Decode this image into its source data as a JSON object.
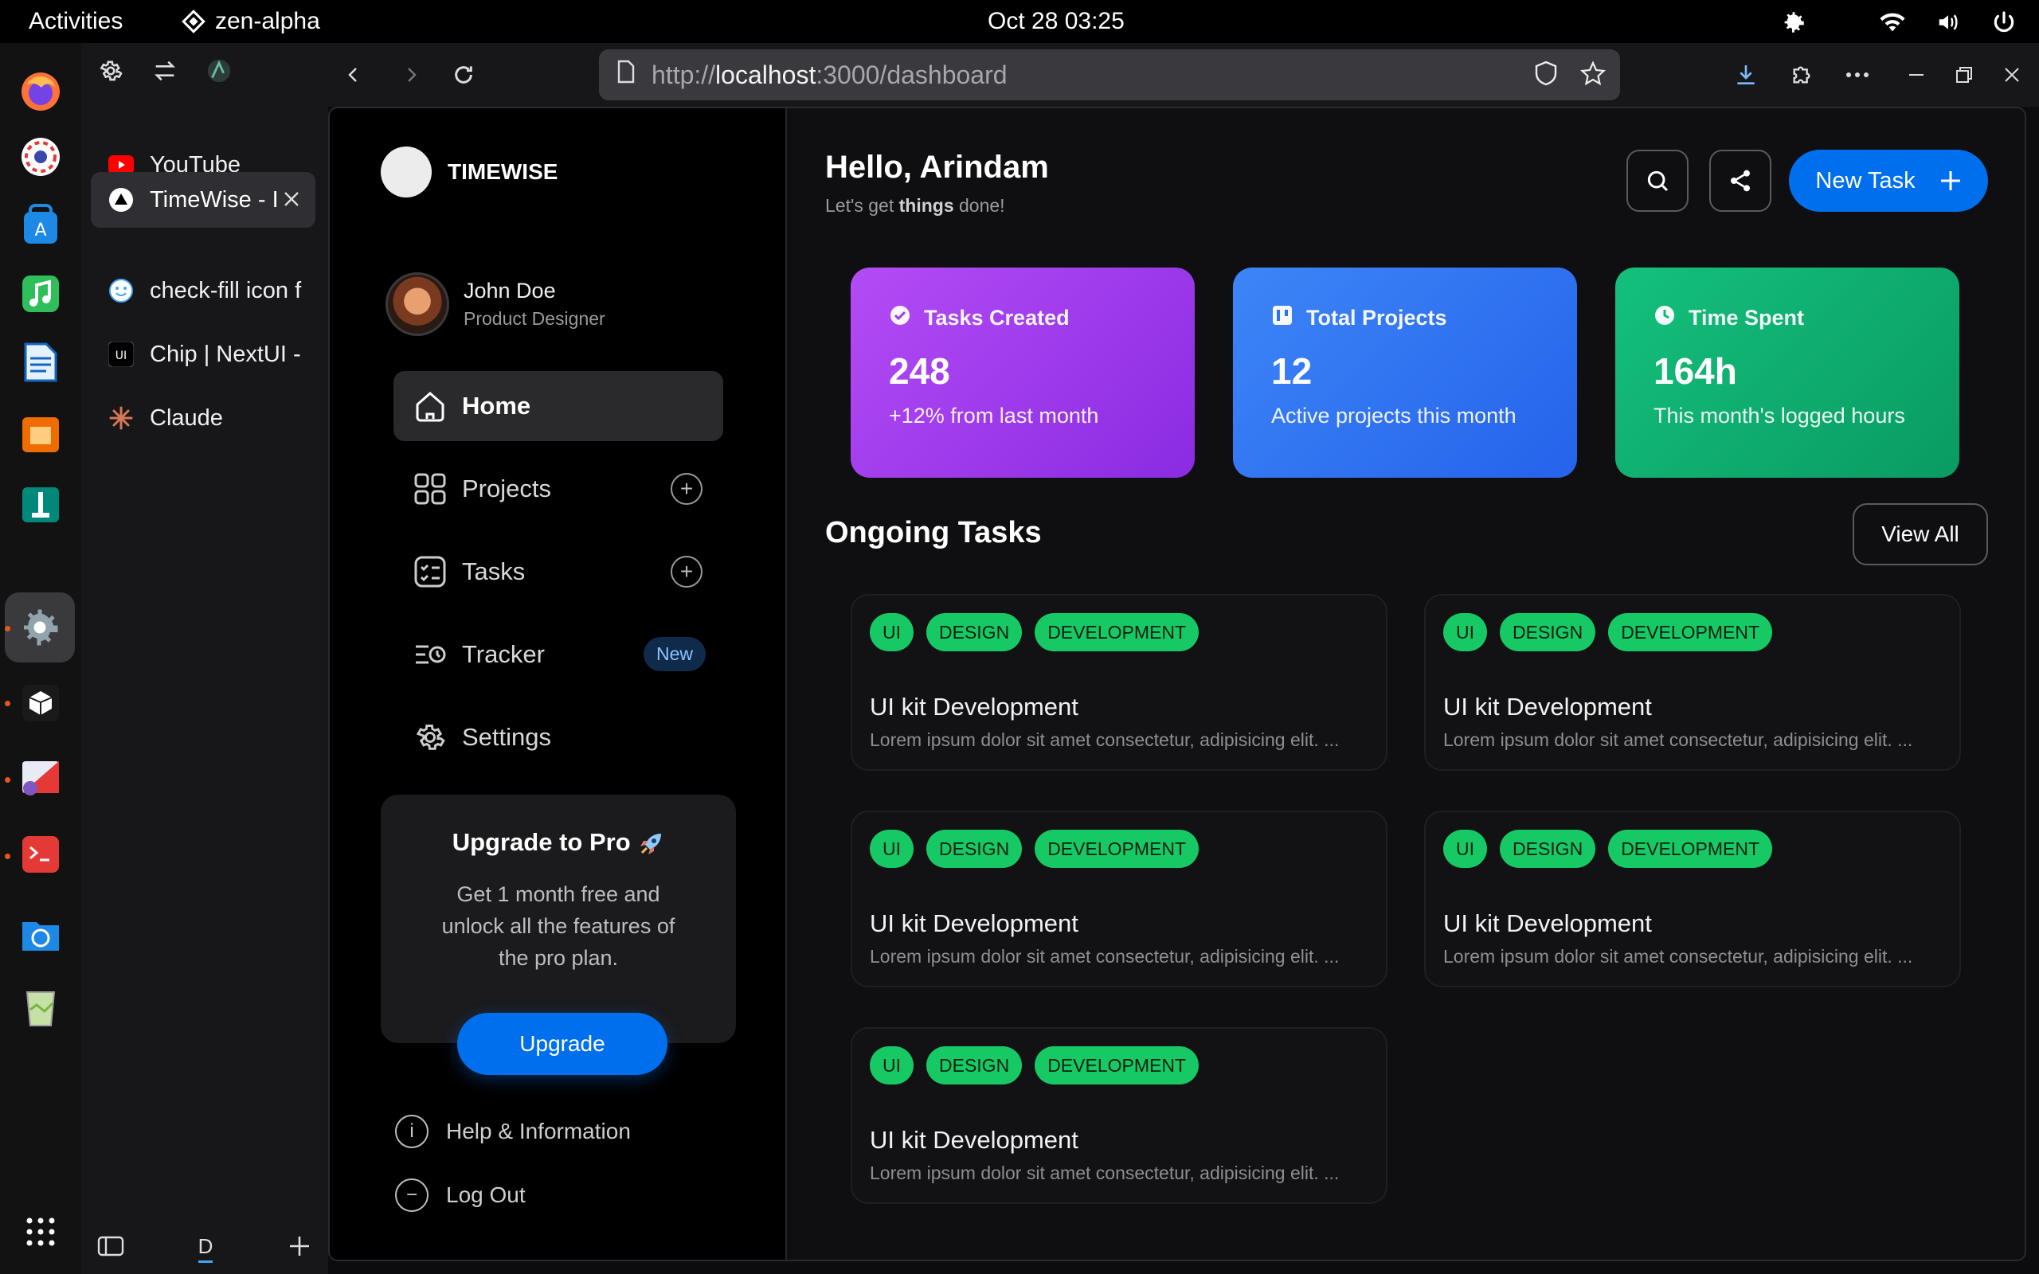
{
  "system": {
    "activities": "Activities",
    "app_name": "zen-alpha",
    "clock": "Oct 28  03:25"
  },
  "browser": {
    "tabs": [
      {
        "label": "YouTube",
        "fav": "youtube-icon",
        "color": "#ff0000"
      },
      {
        "label": "TimeWise - I",
        "fav": "nextjs-icon",
        "color": "#000000",
        "active": true
      },
      {
        "label": "check-fill icon f",
        "fav": "smiley-icon",
        "color": "#42a5f5"
      },
      {
        "label": "Chip | NextUI -",
        "fav": "nextui-icon",
        "color": "#000000"
      },
      {
        "label": "Claude",
        "fav": "claude-icon",
        "color": "#d97757"
      }
    ],
    "url_prefix": "http://",
    "url_host": "localhost",
    "url_rest": ":3000/dashboard",
    "bottom_label": "D"
  },
  "sidebar": {
    "brand": "TIMEWISE",
    "user_name": "John Doe",
    "user_role": "Product Designer",
    "nav": [
      {
        "label": "Home",
        "icon": "home-icon"
      },
      {
        "label": "Projects",
        "icon": "grid-icon"
      },
      {
        "label": "Tasks",
        "icon": "checklist-icon"
      },
      {
        "label": "Tracker",
        "icon": "tracker-icon",
        "badge": "New"
      },
      {
        "label": "Settings",
        "icon": "gear-icon"
      }
    ],
    "promo_title": "Upgrade to Pro",
    "promo_text": "Get 1 month free and unlock all the features of the pro plan.",
    "promo_button": "Upgrade",
    "help": "Help & Information",
    "logout": "Log Out"
  },
  "main": {
    "greeting": "Hello, Arindam",
    "sub_before": "Let's get ",
    "sub_bold": "things",
    "sub_after": " done!",
    "new_task": "New Task",
    "stats": [
      {
        "label": "Tasks Created",
        "value": "248",
        "desc": "+12% from last month",
        "icon": "check-circle-icon"
      },
      {
        "label": "Total Projects",
        "value": "12",
        "desc": "Active projects this month",
        "icon": "kanban-icon"
      },
      {
        "label": "Time Spent",
        "value": "164h",
        "desc": "This month's logged hours",
        "icon": "clock-icon"
      }
    ],
    "section_title": "Ongoing Tasks",
    "view_all": "View All",
    "tasks": [
      {
        "tags": [
          "UI",
          "DESIGN",
          "DEVELOPMENT"
        ],
        "title": "UI kit Development",
        "desc": "Lorem ipsum dolor sit amet consectetur, adipisicing elit. ..."
      },
      {
        "tags": [
          "UI",
          "DESIGN",
          "DEVELOPMENT"
        ],
        "title": "UI kit Development",
        "desc": "Lorem ipsum dolor sit amet consectetur, adipisicing elit. ..."
      },
      {
        "tags": [
          "UI",
          "DESIGN",
          "DEVELOPMENT"
        ],
        "title": "UI kit Development",
        "desc": "Lorem ipsum dolor sit amet consectetur, adipisicing elit. ..."
      },
      {
        "tags": [
          "UI",
          "DESIGN",
          "DEVELOPMENT"
        ],
        "title": "UI kit Development",
        "desc": "Lorem ipsum dolor sit amet consectetur, adipisicing elit. ..."
      },
      {
        "tags": [
          "UI",
          "DESIGN",
          "DEVELOPMENT"
        ],
        "title": "UI kit Development",
        "desc": "Lorem ipsum dolor sit amet consectetur, adipisicing elit. ..."
      }
    ]
  },
  "colors": {
    "accent": "#006fee",
    "tag_green": "#17c964",
    "stat_purple": "#a23ef0",
    "stat_blue": "#2f6ff0",
    "stat_green": "#12b877"
  }
}
